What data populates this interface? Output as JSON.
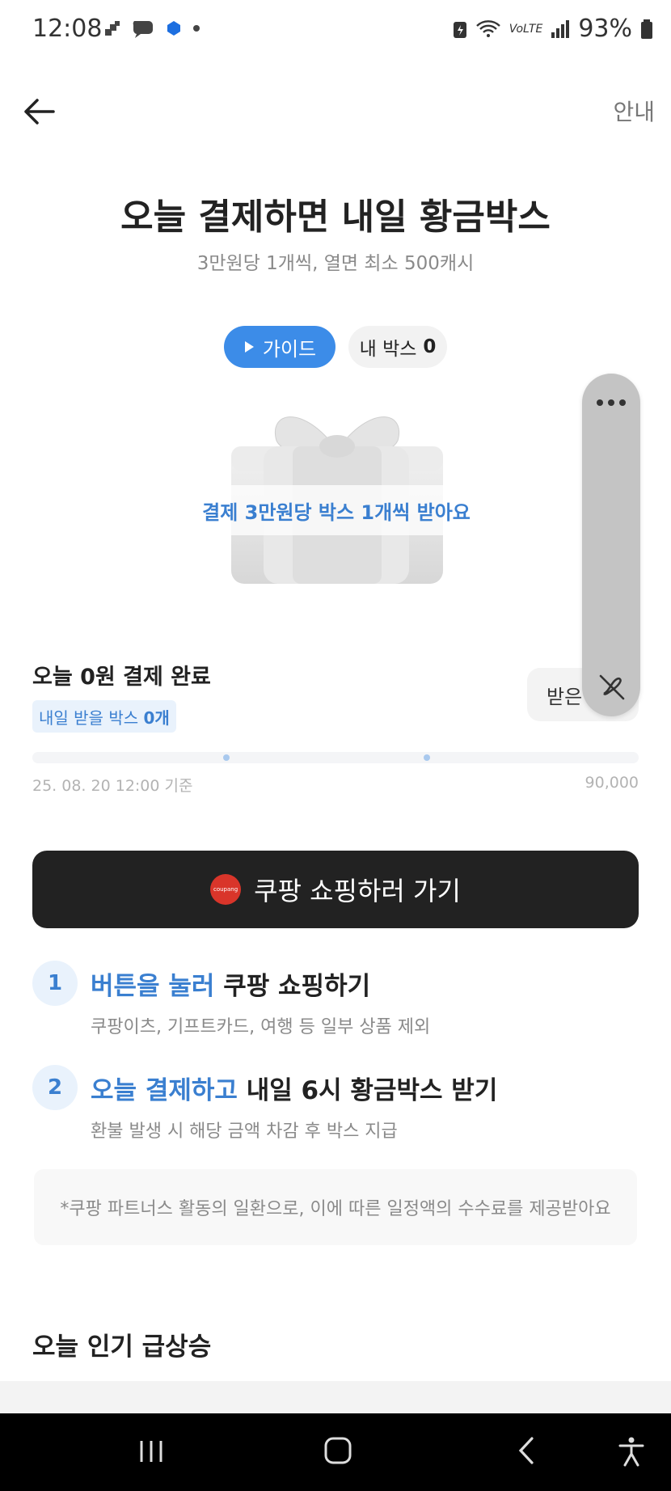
{
  "status_bar": {
    "time": "12:08",
    "battery": "93%",
    "carrier_tag": "VoLTE"
  },
  "header": {
    "back_icon": "arrow-left-icon",
    "guide_link": "안내"
  },
  "hero": {
    "title": "오늘 결제하면 내일 황금박스",
    "subtitle": "3만원당 1개씩, 열면 최소 500캐시",
    "guide_button": "가이드",
    "my_box_label": "내 박스",
    "my_box_count": "0",
    "gift_caption": "결제 3만원당 박스 1개씩 받아요"
  },
  "floating_panel": {
    "received_label": "받은",
    "menu_icon": "more-dots-icon",
    "mute_icon": "mute-icon"
  },
  "progress": {
    "title": "오늘 0원 결제 완료",
    "tomorrow_prefix": "내일 받을 박스",
    "tomorrow_count": "0개",
    "timestamp": "25. 08. 20 12:00 기준",
    "max_value": "90,000",
    "fill_fraction": 0
  },
  "cta": {
    "logo_text": "coupang",
    "label": "쿠팡 쇼핑하러 가기"
  },
  "steps": [
    {
      "number": "1",
      "accent": "버튼을 눌러",
      "rest": " 쿠팡 쇼핑하기",
      "desc": "쿠팡이츠, 기프트카드, 여행 등 일부 상품 제외"
    },
    {
      "number": "2",
      "accent": "오늘 결제하고",
      "rest": " 내일 6시 황금박스 받기",
      "desc": "환불 발생 시 해당 금액 차감 후 박스 지급"
    }
  ],
  "notice": "*쿠팡 파트너스 활동의 일환으로, 이에 따른 일정액의 수수료를 제공받아요",
  "popular": {
    "title": "오늘 인기 급상승"
  },
  "colors": {
    "accent": "#3c8ce8",
    "cta_bg": "#222222",
    "badge_bg": "#e9f2fc"
  }
}
